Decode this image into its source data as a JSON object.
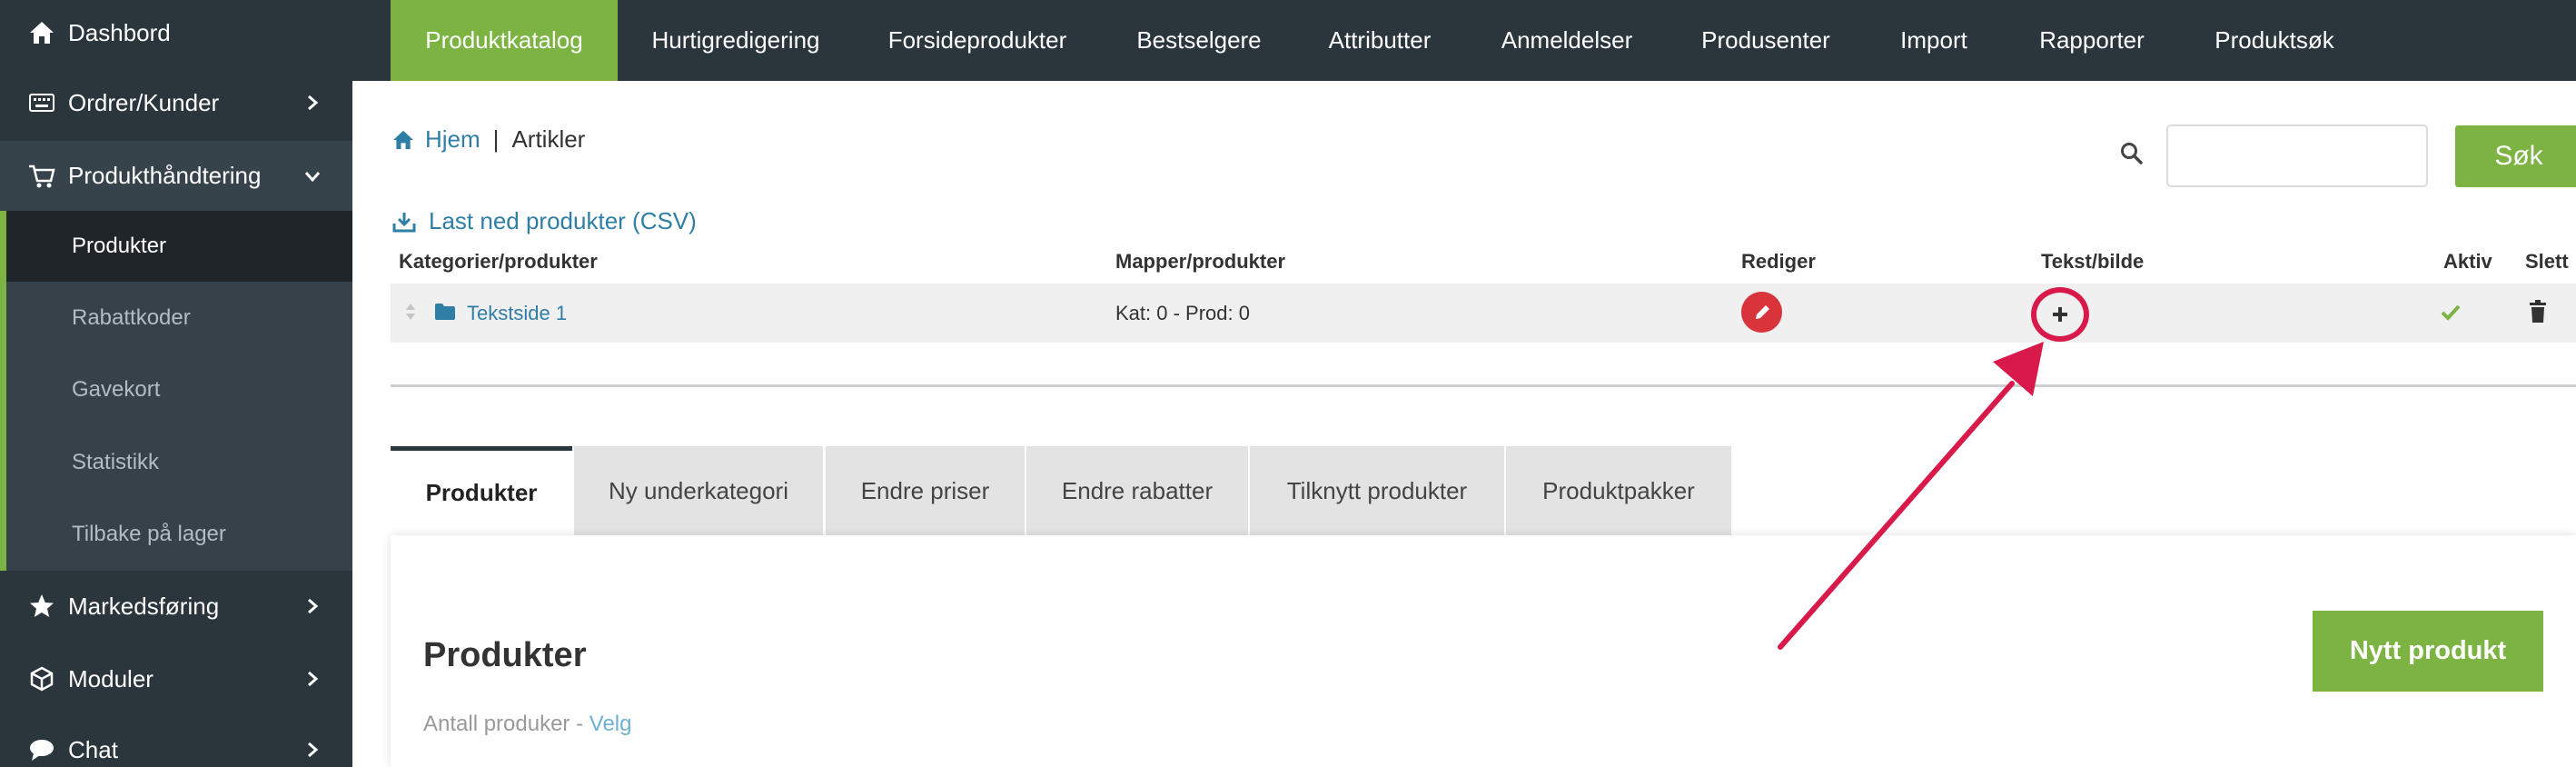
{
  "sidebar": {
    "items": [
      {
        "label": "Dashbord",
        "icon": "home-icon"
      },
      {
        "label": "Ordrer/Kunder",
        "icon": "keyboard-icon"
      },
      {
        "label": "Produkthåndtering",
        "icon": "cart-icon"
      },
      {
        "label": "Markedsføring",
        "icon": "star-icon"
      },
      {
        "label": "Moduler",
        "icon": "cube-icon"
      },
      {
        "label": "Chat",
        "icon": "chat-icon"
      }
    ],
    "subitems": [
      {
        "label": "Produkter"
      },
      {
        "label": "Rabattkoder"
      },
      {
        "label": "Gavekort"
      },
      {
        "label": "Statistikk"
      },
      {
        "label": "Tilbake på lager"
      }
    ]
  },
  "topnav": {
    "items": [
      "Produktkatalog",
      "Hurtigredigering",
      "Forsideprodukter",
      "Bestselgere",
      "Attributter",
      "Anmeldelser",
      "Produsenter",
      "Import",
      "Rapporter",
      "Produktsøk"
    ]
  },
  "breadcrumb": {
    "home": "Hjem",
    "separator": "|",
    "current": "Artikler"
  },
  "search": {
    "value": "",
    "placeholder": "",
    "button": "Søk"
  },
  "download": {
    "label": "Last ned produkter (CSV)"
  },
  "table": {
    "headers": [
      "Kategorier/produkter",
      "Mapper/produkter",
      "Rediger",
      "Tekst/bilde",
      "Aktiv",
      "Slett"
    ],
    "rows": [
      {
        "name": "Tekstside 1",
        "count": "Kat: 0 - Prod: 0"
      }
    ]
  },
  "tabs": [
    "Produkter",
    "Ny underkategori",
    "Endre priser",
    "Endre rabatter",
    "Tilknytt produkter",
    "Produktpakker"
  ],
  "panel": {
    "title": "Produkter",
    "count_label": "Antall produker - ",
    "count_link": "Velg",
    "new_button": "Nytt produkt"
  },
  "colors": {
    "sidebar": "#2b353c",
    "accent_green": "#7cb342",
    "link": "#2f7ea6",
    "edit_red": "#d9343c",
    "highlight": "#d81a4a"
  }
}
